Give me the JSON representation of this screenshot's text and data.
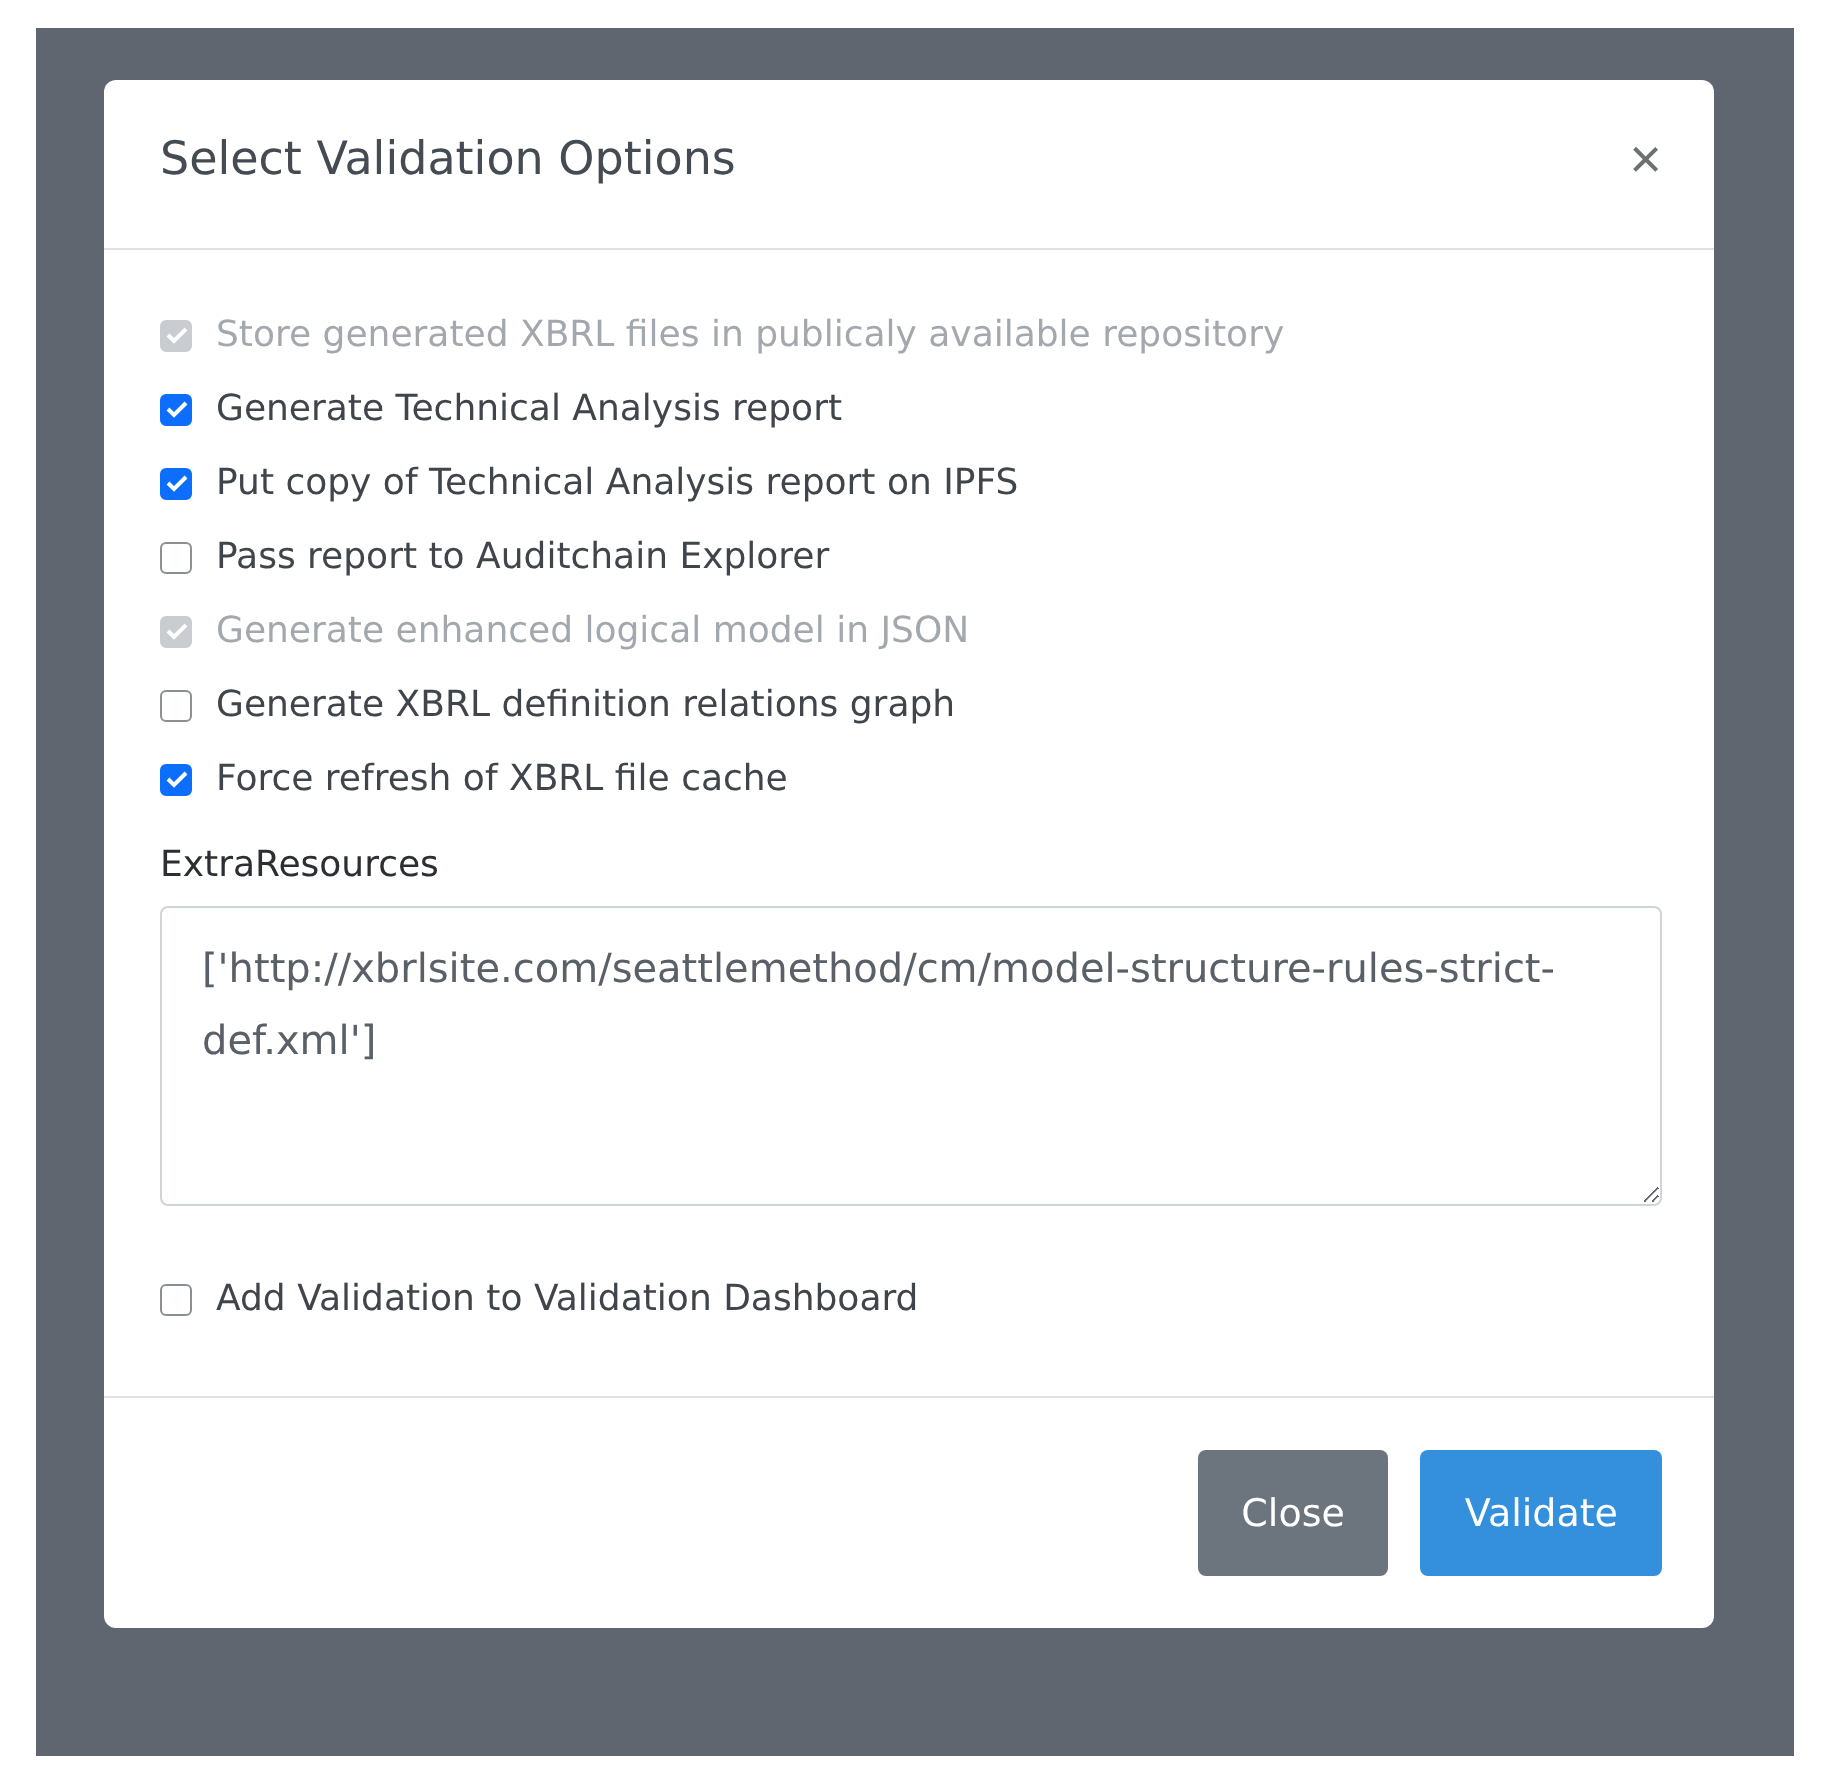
{
  "dialog": {
    "title": "Select Validation Options",
    "close_symbol": "×"
  },
  "options": [
    {
      "label": "Store generated XBRL files in publicaly available repository",
      "checked": true,
      "disabled": true
    },
    {
      "label": "Generate Technical Analysis report",
      "checked": true,
      "disabled": false
    },
    {
      "label": "Put copy of Technical Analysis report on IPFS",
      "checked": true,
      "disabled": false
    },
    {
      "label": "Pass report to Auditchain Explorer",
      "checked": false,
      "disabled": false
    },
    {
      "label": "Generate enhanced logical model in JSON",
      "checked": true,
      "disabled": true
    },
    {
      "label": "Generate XBRL definition relations graph",
      "checked": false,
      "disabled": false
    },
    {
      "label": "Force refresh of XBRL file cache",
      "checked": true,
      "disabled": false
    }
  ],
  "extra_resources": {
    "label": "ExtraResources",
    "value": "['http://xbrlsite.com/seattlemethod/cm/model-structure-rules-strict-def.xml']"
  },
  "dashboard_option": {
    "label": "Add Validation to Validation Dashboard",
    "checked": false,
    "disabled": false
  },
  "buttons": [
    {
      "label": "Close",
      "kind": "secondary"
    },
    {
      "label": "Validate",
      "kind": "primary"
    }
  ]
}
